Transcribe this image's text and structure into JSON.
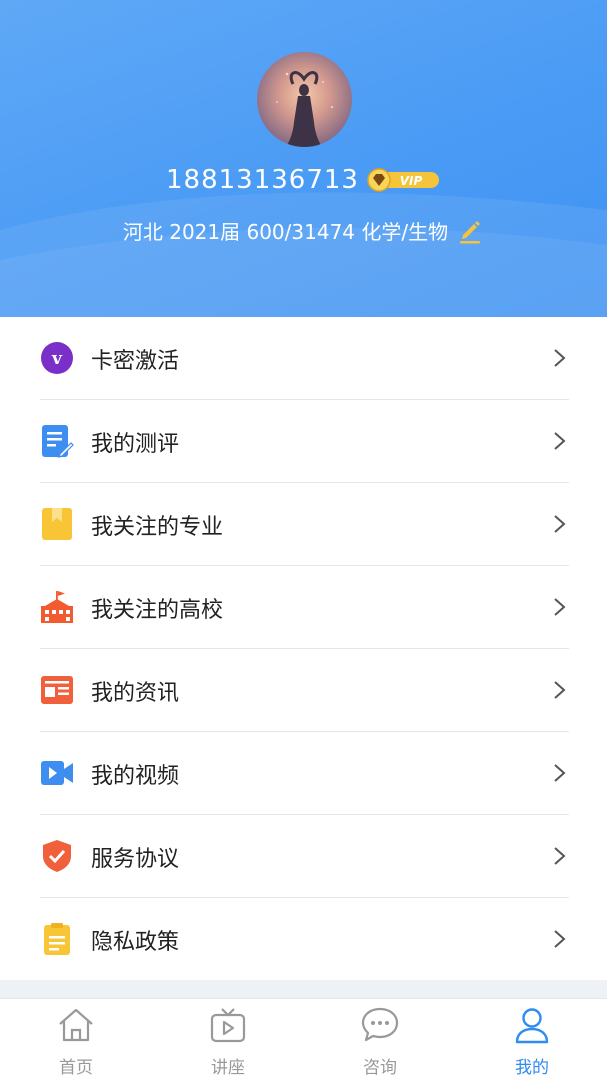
{
  "profile": {
    "phone": "18813136713",
    "vip_label": "VIP",
    "info": "河北 2021届 600/31474 化学/生物"
  },
  "menu": {
    "items": [
      {
        "label": "卡密激活",
        "icon": "v-circle-icon"
      },
      {
        "label": "我的测评",
        "icon": "document-edit-icon"
      },
      {
        "label": "我关注的专业",
        "icon": "bookmark-book-icon"
      },
      {
        "label": "我关注的高校",
        "icon": "school-building-icon"
      },
      {
        "label": "我的资讯",
        "icon": "news-icon"
      },
      {
        "label": "我的视频",
        "icon": "video-camera-icon"
      },
      {
        "label": "服务协议",
        "icon": "shield-check-icon"
      },
      {
        "label": "隐私政策",
        "icon": "clipboard-icon"
      }
    ]
  },
  "tabbar": {
    "tabs": [
      {
        "label": "首页",
        "icon": "home-icon",
        "active": false
      },
      {
        "label": "讲座",
        "icon": "tv-play-icon",
        "active": false
      },
      {
        "label": "咨询",
        "icon": "chat-bubble-icon",
        "active": false
      },
      {
        "label": "我的",
        "icon": "user-icon",
        "active": true
      }
    ]
  },
  "colors": {
    "header_blue": "#4a9bf5",
    "active_tab": "#2f8cf0",
    "inactive_tab": "#999999",
    "vip_gold": "#f6c43a"
  }
}
